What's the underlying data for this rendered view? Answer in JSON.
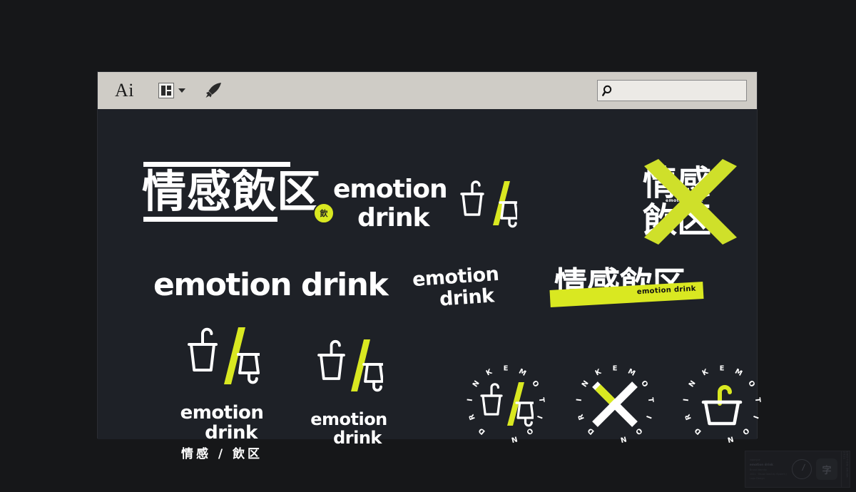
{
  "app": {
    "name": "Ai",
    "toolbar": {
      "arrange_label": "Arrange Documents",
      "rocket_label": "Share on Behance",
      "search_placeholder": "",
      "search_value": "",
      "search_icon": "search-icon"
    }
  },
  "brand": {
    "accent": "#d9e821",
    "white": "#ffffff",
    "canvas_bg": "#1e2127",
    "page_bg": "#161719",
    "toolbar_bg": "#cfccc6"
  },
  "artboard": {
    "items": [
      {
        "id": "logo-cjk-horizontal",
        "cjk": "情感飲区",
        "seal": "飲",
        "note": "horizontal CJK lockup with accent seal"
      },
      {
        "id": "logo-latin-cups",
        "line1": "emotion",
        "line2": "drink",
        "mark": "cup-slash-cup"
      },
      {
        "id": "logo-cjk-stacked-x",
        "row1": "情感",
        "row2": "飲区",
        "micro": "emotion drink",
        "overlay": "x-mark"
      },
      {
        "id": "wordmark-large",
        "text": "emotion drink"
      },
      {
        "id": "wordmark-stacked-tilt",
        "line1": "emotion",
        "line2": "drink"
      },
      {
        "id": "logo-cjk-band",
        "cjk": "情感飲区",
        "band_label": "emotion drink"
      },
      {
        "id": "logo-mark-full",
        "line1": "emotion",
        "line2": "drink",
        "cn": "情感 / 飲区"
      },
      {
        "id": "logo-mark-latin",
        "line1": "emotion",
        "line2": "drink"
      },
      {
        "id": "badge-cups",
        "ring_text": "EMOTION DRINK",
        "core": "cup-slash-cup"
      },
      {
        "id": "badge-x",
        "ring_text": "EMOTION DRINK",
        "core": "x-mark"
      },
      {
        "id": "badge-cup-straw",
        "ring_text": "EMOTION DRINK",
        "core": "cup-straw"
      }
    ]
  },
  "watermark": {
    "heading": "logotype",
    "title": "emotion drink",
    "line1": "Brand Identity",
    "line2": "2021 · Visual Identity System / Logo Design",
    "badge": "字",
    "strip": "EMOTION DRINK  2021"
  }
}
